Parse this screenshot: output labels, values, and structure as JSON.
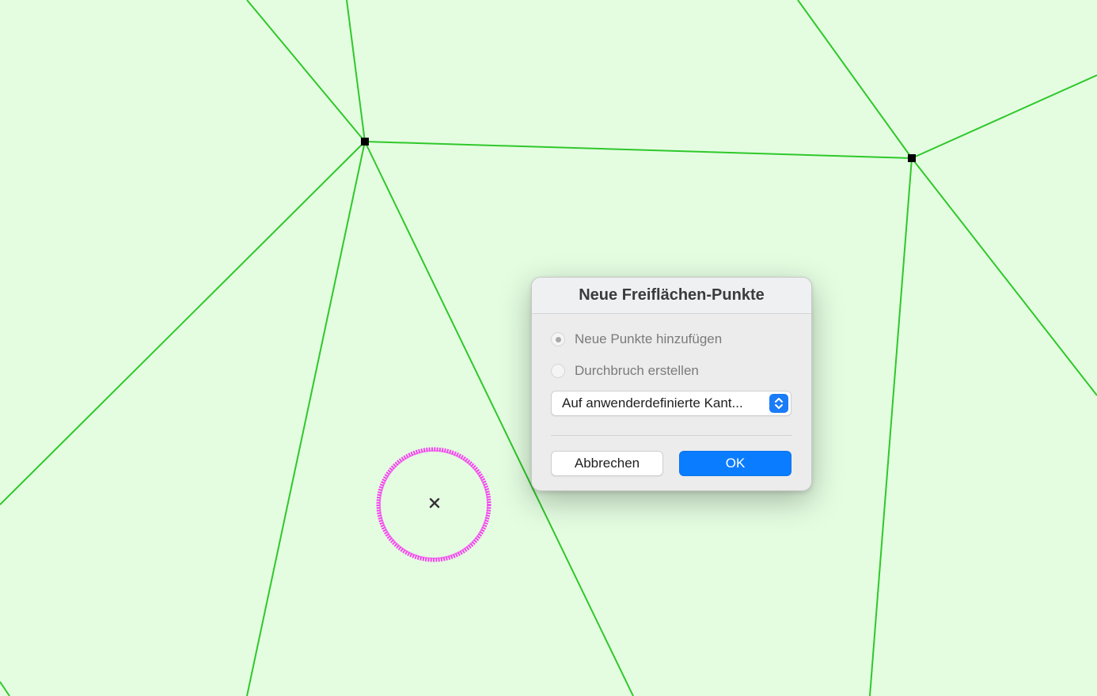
{
  "canvas": {
    "background_color": "#e4fde1",
    "edge_color": "#2fc82a",
    "vertex_color": "#000000",
    "cursor_ring_color": "#f542f0",
    "cursor_marker_icon": "close-x-icon"
  },
  "dialog": {
    "title": "Neue Freiflächen-Punkte",
    "options": [
      {
        "label": "Neue Punkte hinzufügen",
        "selected": true
      },
      {
        "label": "Durchbruch erstellen",
        "selected": false
      }
    ],
    "select": {
      "value": "Auf anwenderdefinierte Kant...",
      "icon": "chevron-up-down-icon"
    },
    "cancel_label": "Abbrechen",
    "ok_label": "OK",
    "accent_color": "#0a7cff"
  }
}
